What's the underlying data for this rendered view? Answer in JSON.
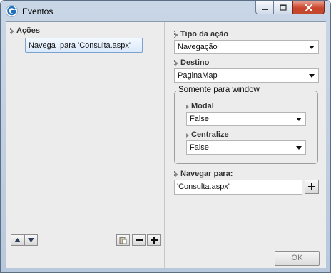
{
  "window": {
    "title": "Eventos",
    "accent_color": "#1f6fbf",
    "close_color": "#c8432b"
  },
  "left_panel": {
    "header": "Ações",
    "items": [
      {
        "label": "Navega  para 'Consulta.aspx'",
        "selected": true
      }
    ],
    "toolbar": {
      "move_up_icon": "arrow-up-icon",
      "move_down_icon": "arrow-down-icon",
      "paste_icon": "clipboard-icon",
      "remove_icon": "minus-icon",
      "add_icon": "plus-icon"
    }
  },
  "properties": {
    "tipo_label": "Tipo da ação",
    "tipo_value": "Navegação",
    "destino_label": "Destino",
    "destino_value": "PaginaMap",
    "group_title": "Somente para window",
    "modal_label": "Modal",
    "modal_value": "False",
    "centralize_label": "Centralize",
    "centralize_value": "False",
    "navegar_label": "Navegar para:",
    "navegar_value": "'Consulta.aspx'"
  },
  "footer": {
    "ok_label": "OK"
  }
}
